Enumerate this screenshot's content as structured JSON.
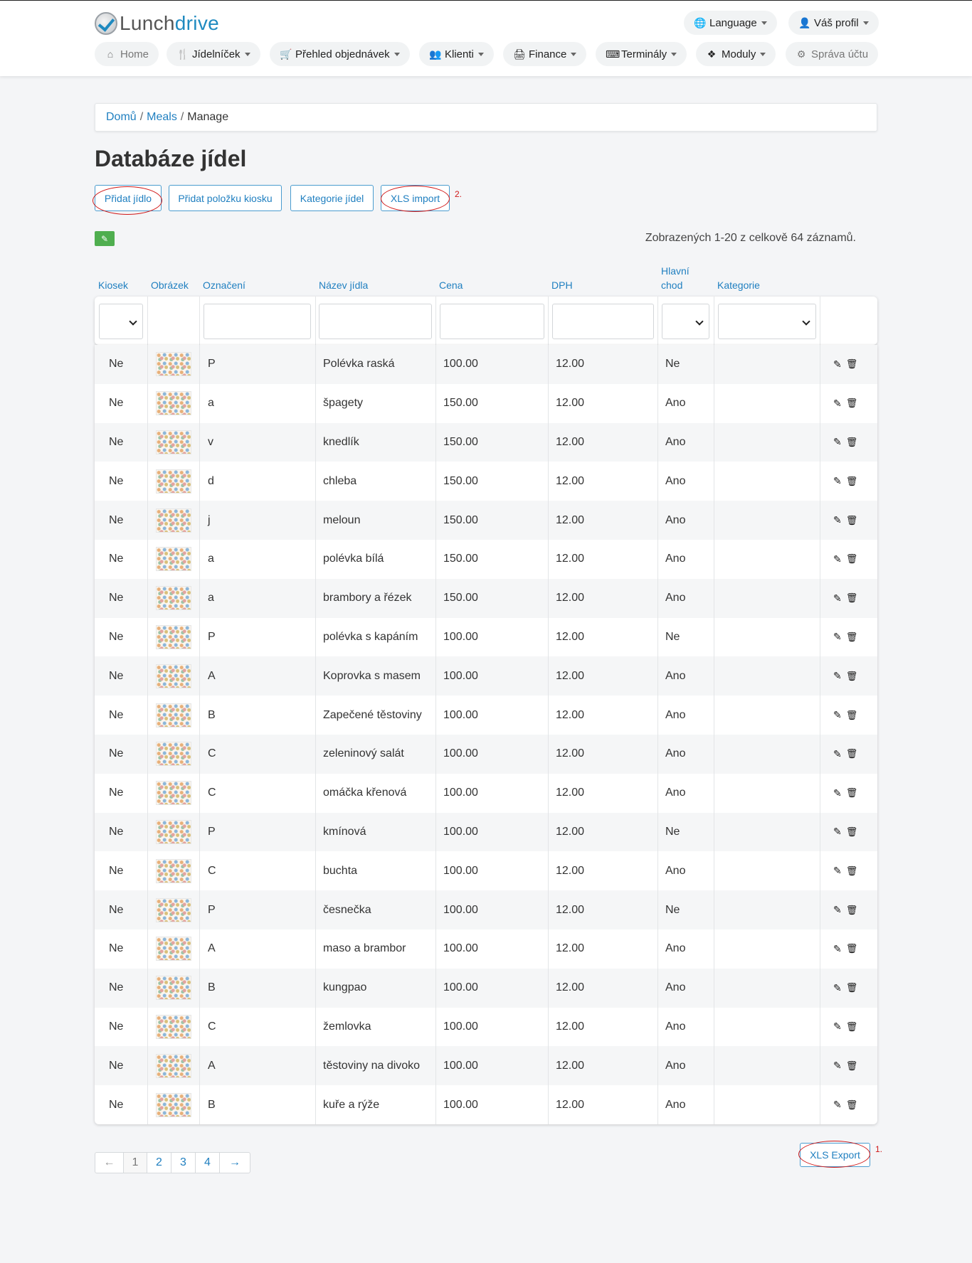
{
  "brand": {
    "part1": "Lunch",
    "part2": "drive"
  },
  "header": {
    "language": "Language",
    "profile": "Váš profil",
    "nav": [
      {
        "label": "Home",
        "icon": "home-icon"
      },
      {
        "label": "Jídelníček",
        "icon": "utensils-icon"
      },
      {
        "label": "Přehled objednávek",
        "icon": "basket-icon"
      },
      {
        "label": "Klienti",
        "icon": "users-icon"
      },
      {
        "label": "Finance",
        "icon": "cash-register-icon"
      },
      {
        "label": "Terminály",
        "icon": "terminal-icon"
      },
      {
        "label": "Moduly",
        "icon": "modules-icon"
      },
      {
        "label": "Správa účtu",
        "icon": "gear-icon"
      }
    ]
  },
  "breadcrumb": {
    "home": "Domů",
    "meals": "Meals",
    "current": "Manage",
    "sep": "/"
  },
  "page": {
    "title": "Databáze jídel"
  },
  "actions": {
    "add_meal": "Přidat jídlo",
    "add_kiosk": "Přidat položku kiosku",
    "categories": "Kategorie jídel",
    "xls_import": "XLS import",
    "xls_export": "XLS Export"
  },
  "annotations": {
    "import_marker": "2.",
    "export_marker": "1."
  },
  "counter": "Zobrazených 1-20 z celkově 64 záznamů.",
  "columns": {
    "kiosk": "Kiosek",
    "image": "Obrázek",
    "code": "Označení",
    "name": "Název jídla",
    "price": "Cena",
    "vat": "DPH",
    "main_1": "Hlavní",
    "main_2": "chod",
    "category": "Kategorie"
  },
  "rows": [
    {
      "kiosk": "Ne",
      "code": "P",
      "name": "Polévka raská",
      "price": "100.00",
      "vat": "12.00",
      "main": "Ne",
      "category": ""
    },
    {
      "kiosk": "Ne",
      "code": "a",
      "name": "špagety",
      "price": "150.00",
      "vat": "12.00",
      "main": "Ano",
      "category": ""
    },
    {
      "kiosk": "Ne",
      "code": "v",
      "name": "knedlík",
      "price": "150.00",
      "vat": "12.00",
      "main": "Ano",
      "category": ""
    },
    {
      "kiosk": "Ne",
      "code": "d",
      "name": "chleba",
      "price": "150.00",
      "vat": "12.00",
      "main": "Ano",
      "category": ""
    },
    {
      "kiosk": "Ne",
      "code": "j",
      "name": "meloun",
      "price": "150.00",
      "vat": "12.00",
      "main": "Ano",
      "category": ""
    },
    {
      "kiosk": "Ne",
      "code": "a",
      "name": "polévka bílá",
      "price": "150.00",
      "vat": "12.00",
      "main": "Ano",
      "category": ""
    },
    {
      "kiosk": "Ne",
      "code": "a",
      "name": "brambory a řézek",
      "price": "150.00",
      "vat": "12.00",
      "main": "Ano",
      "category": ""
    },
    {
      "kiosk": "Ne",
      "code": "P",
      "name": "polévka s kapáním",
      "price": "100.00",
      "vat": "12.00",
      "main": "Ne",
      "category": ""
    },
    {
      "kiosk": "Ne",
      "code": "A",
      "name": "Koprovka s masem",
      "price": "100.00",
      "vat": "12.00",
      "main": "Ano",
      "category": ""
    },
    {
      "kiosk": "Ne",
      "code": "B",
      "name": "Zapečené těstoviny",
      "price": "100.00",
      "vat": "12.00",
      "main": "Ano",
      "category": ""
    },
    {
      "kiosk": "Ne",
      "code": "C",
      "name": "zeleninový salát",
      "price": "100.00",
      "vat": "12.00",
      "main": "Ano",
      "category": ""
    },
    {
      "kiosk": "Ne",
      "code": "C",
      "name": "omáčka křenová",
      "price": "100.00",
      "vat": "12.00",
      "main": "Ano",
      "category": ""
    },
    {
      "kiosk": "Ne",
      "code": "P",
      "name": "kmínová",
      "price": "100.00",
      "vat": "12.00",
      "main": "Ne",
      "category": ""
    },
    {
      "kiosk": "Ne",
      "code": "C",
      "name": "buchta",
      "price": "100.00",
      "vat": "12.00",
      "main": "Ano",
      "category": ""
    },
    {
      "kiosk": "Ne",
      "code": "P",
      "name": "česnečka",
      "price": "100.00",
      "vat": "12.00",
      "main": "Ne",
      "category": ""
    },
    {
      "kiosk": "Ne",
      "code": "A",
      "name": "maso a brambor",
      "price": "100.00",
      "vat": "12.00",
      "main": "Ano",
      "category": ""
    },
    {
      "kiosk": "Ne",
      "code": "B",
      "name": "kungpao",
      "price": "100.00",
      "vat": "12.00",
      "main": "Ano",
      "category": ""
    },
    {
      "kiosk": "Ne",
      "code": "C",
      "name": "žemlovka",
      "price": "100.00",
      "vat": "12.00",
      "main": "Ano",
      "category": ""
    },
    {
      "kiosk": "Ne",
      "code": "A",
      "name": "těstoviny na divoko",
      "price": "100.00",
      "vat": "12.00",
      "main": "Ano",
      "category": ""
    },
    {
      "kiosk": "Ne",
      "code": "B",
      "name": "kuře a rýže",
      "price": "100.00",
      "vat": "12.00",
      "main": "Ano",
      "category": ""
    }
  ],
  "pagination": {
    "prev": "←",
    "pages": [
      "1",
      "2",
      "3",
      "4"
    ],
    "next": "→",
    "current": "1"
  },
  "colors": {
    "accent": "#1f7fc0",
    "edit_green": "#4fae4f",
    "annotation_red": "#d01818"
  }
}
